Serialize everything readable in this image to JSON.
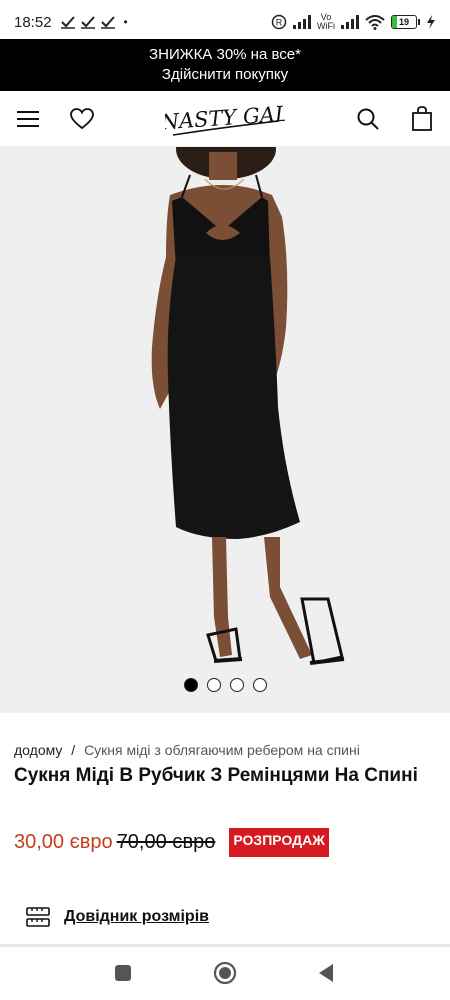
{
  "status_bar": {
    "time": "18:52",
    "dot": "•",
    "battery_level": "19",
    "battery_fraction": 0.19,
    "network_label": "Vo WiFi",
    "icons": [
      "check-icon",
      "check-icon",
      "check-icon",
      "r-circle-icon",
      "signal-icon",
      "vowifi-icon",
      "wifi-icon",
      "battery-icon",
      "charging-icon"
    ]
  },
  "promo": {
    "line1": "ЗНИЖКА 30% на все*",
    "line2": "Здійснити покупку"
  },
  "header": {
    "logo_text": "NASTY GAL",
    "icons": [
      "menu-icon",
      "heart-icon",
      "search-icon",
      "bag-icon"
    ]
  },
  "gallery": {
    "slide_count": 4,
    "active_index": 0,
    "background_color": "#efeff0"
  },
  "breadcrumb": {
    "home": "додому",
    "separator": "/",
    "current": "Сукня міді з облягаючим ребером на спині"
  },
  "product": {
    "title": "Сукня Міді В Рубчик З Ремінцями На Спині",
    "price_sale": "30,00 євро",
    "price_old": "70,00 євро",
    "badge": "РОЗПРОДАЖ",
    "sale_color": "#c53d1d",
    "badge_color": "#d71920"
  },
  "size_guide": {
    "label": "Довідник розмірів",
    "icon": "ruler-icon"
  },
  "nav_bar": {
    "icons": [
      "recents-square-icon",
      "home-circle-icon",
      "back-triangle-icon"
    ]
  }
}
